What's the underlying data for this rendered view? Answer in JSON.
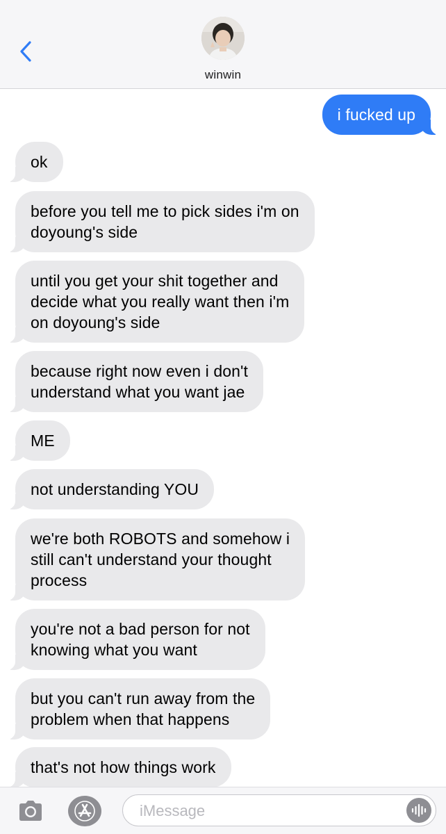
{
  "header": {
    "contact_name": "winwin",
    "back_icon": "chevron-left-icon",
    "avatar_icon": "contact-photo"
  },
  "messages": [
    {
      "direction": "outgoing",
      "text": "i fucked up"
    },
    {
      "direction": "incoming",
      "text": "ok"
    },
    {
      "direction": "incoming",
      "text": "before you tell me to pick sides i'm on\ndoyoung's side"
    },
    {
      "direction": "incoming",
      "text": "until you get your shit together and\ndecide what you really want then i'm\non doyoung's side"
    },
    {
      "direction": "incoming",
      "text": "because right now even i don't\nunderstand what you want jae"
    },
    {
      "direction": "incoming",
      "text": "ME"
    },
    {
      "direction": "incoming",
      "text": "not understanding YOU"
    },
    {
      "direction": "incoming",
      "text": "we're both ROBOTS and somehow i\nstill can't understand your thought\nprocess"
    },
    {
      "direction": "incoming",
      "text": "you're not a bad person for not\nknowing what you want"
    },
    {
      "direction": "incoming",
      "text": "but you can't run away from the\nproblem when that happens"
    },
    {
      "direction": "incoming",
      "text": "that's not how things work"
    }
  ],
  "input_bar": {
    "placeholder": "iMessage",
    "camera_icon": "camera-icon",
    "apps_icon": "app-store-icon",
    "audio_icon": "audio-waveform-icon"
  },
  "colors": {
    "outgoing_bubble": "#2f7cf6",
    "incoming_bubble": "#e9e9eb",
    "accent": "#2f7cf6"
  }
}
